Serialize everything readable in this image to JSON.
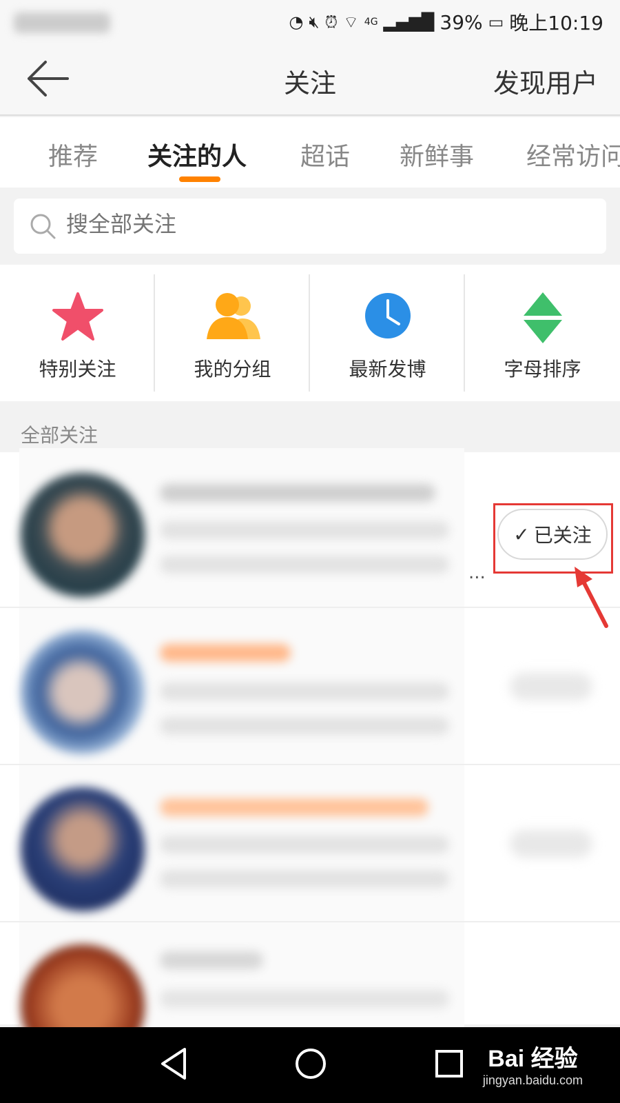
{
  "status_bar": {
    "battery": "39%",
    "time": "晚上10:19",
    "network": "4G"
  },
  "nav": {
    "title": "关注",
    "right_action": "发现用户"
  },
  "tabs": [
    {
      "label": "推荐"
    },
    {
      "label": "关注的人"
    },
    {
      "label": "超话"
    },
    {
      "label": "新鲜事"
    },
    {
      "label": "经常访问"
    }
  ],
  "search": {
    "placeholder": "搜全部关注"
  },
  "shortcuts": [
    {
      "label": "特别关注",
      "icon": "star-icon",
      "color": "#f04f6a"
    },
    {
      "label": "我的分组",
      "icon": "group-icon",
      "color": "#ffae1c"
    },
    {
      "label": "最新发博",
      "icon": "clock-icon",
      "color": "#2b8fe6"
    },
    {
      "label": "字母排序",
      "icon": "sort-icon",
      "color": "#3fbf6b"
    }
  ],
  "section": {
    "label": "全部关注"
  },
  "following_list": {
    "first_row_button": "已关注",
    "first_row_ellipsis": "..."
  },
  "watermark": {
    "main": "Bai 经验",
    "sub": "jingyan.baidu.com"
  },
  "colors": {
    "accent": "#ff8200",
    "highlight": "#e53935"
  }
}
